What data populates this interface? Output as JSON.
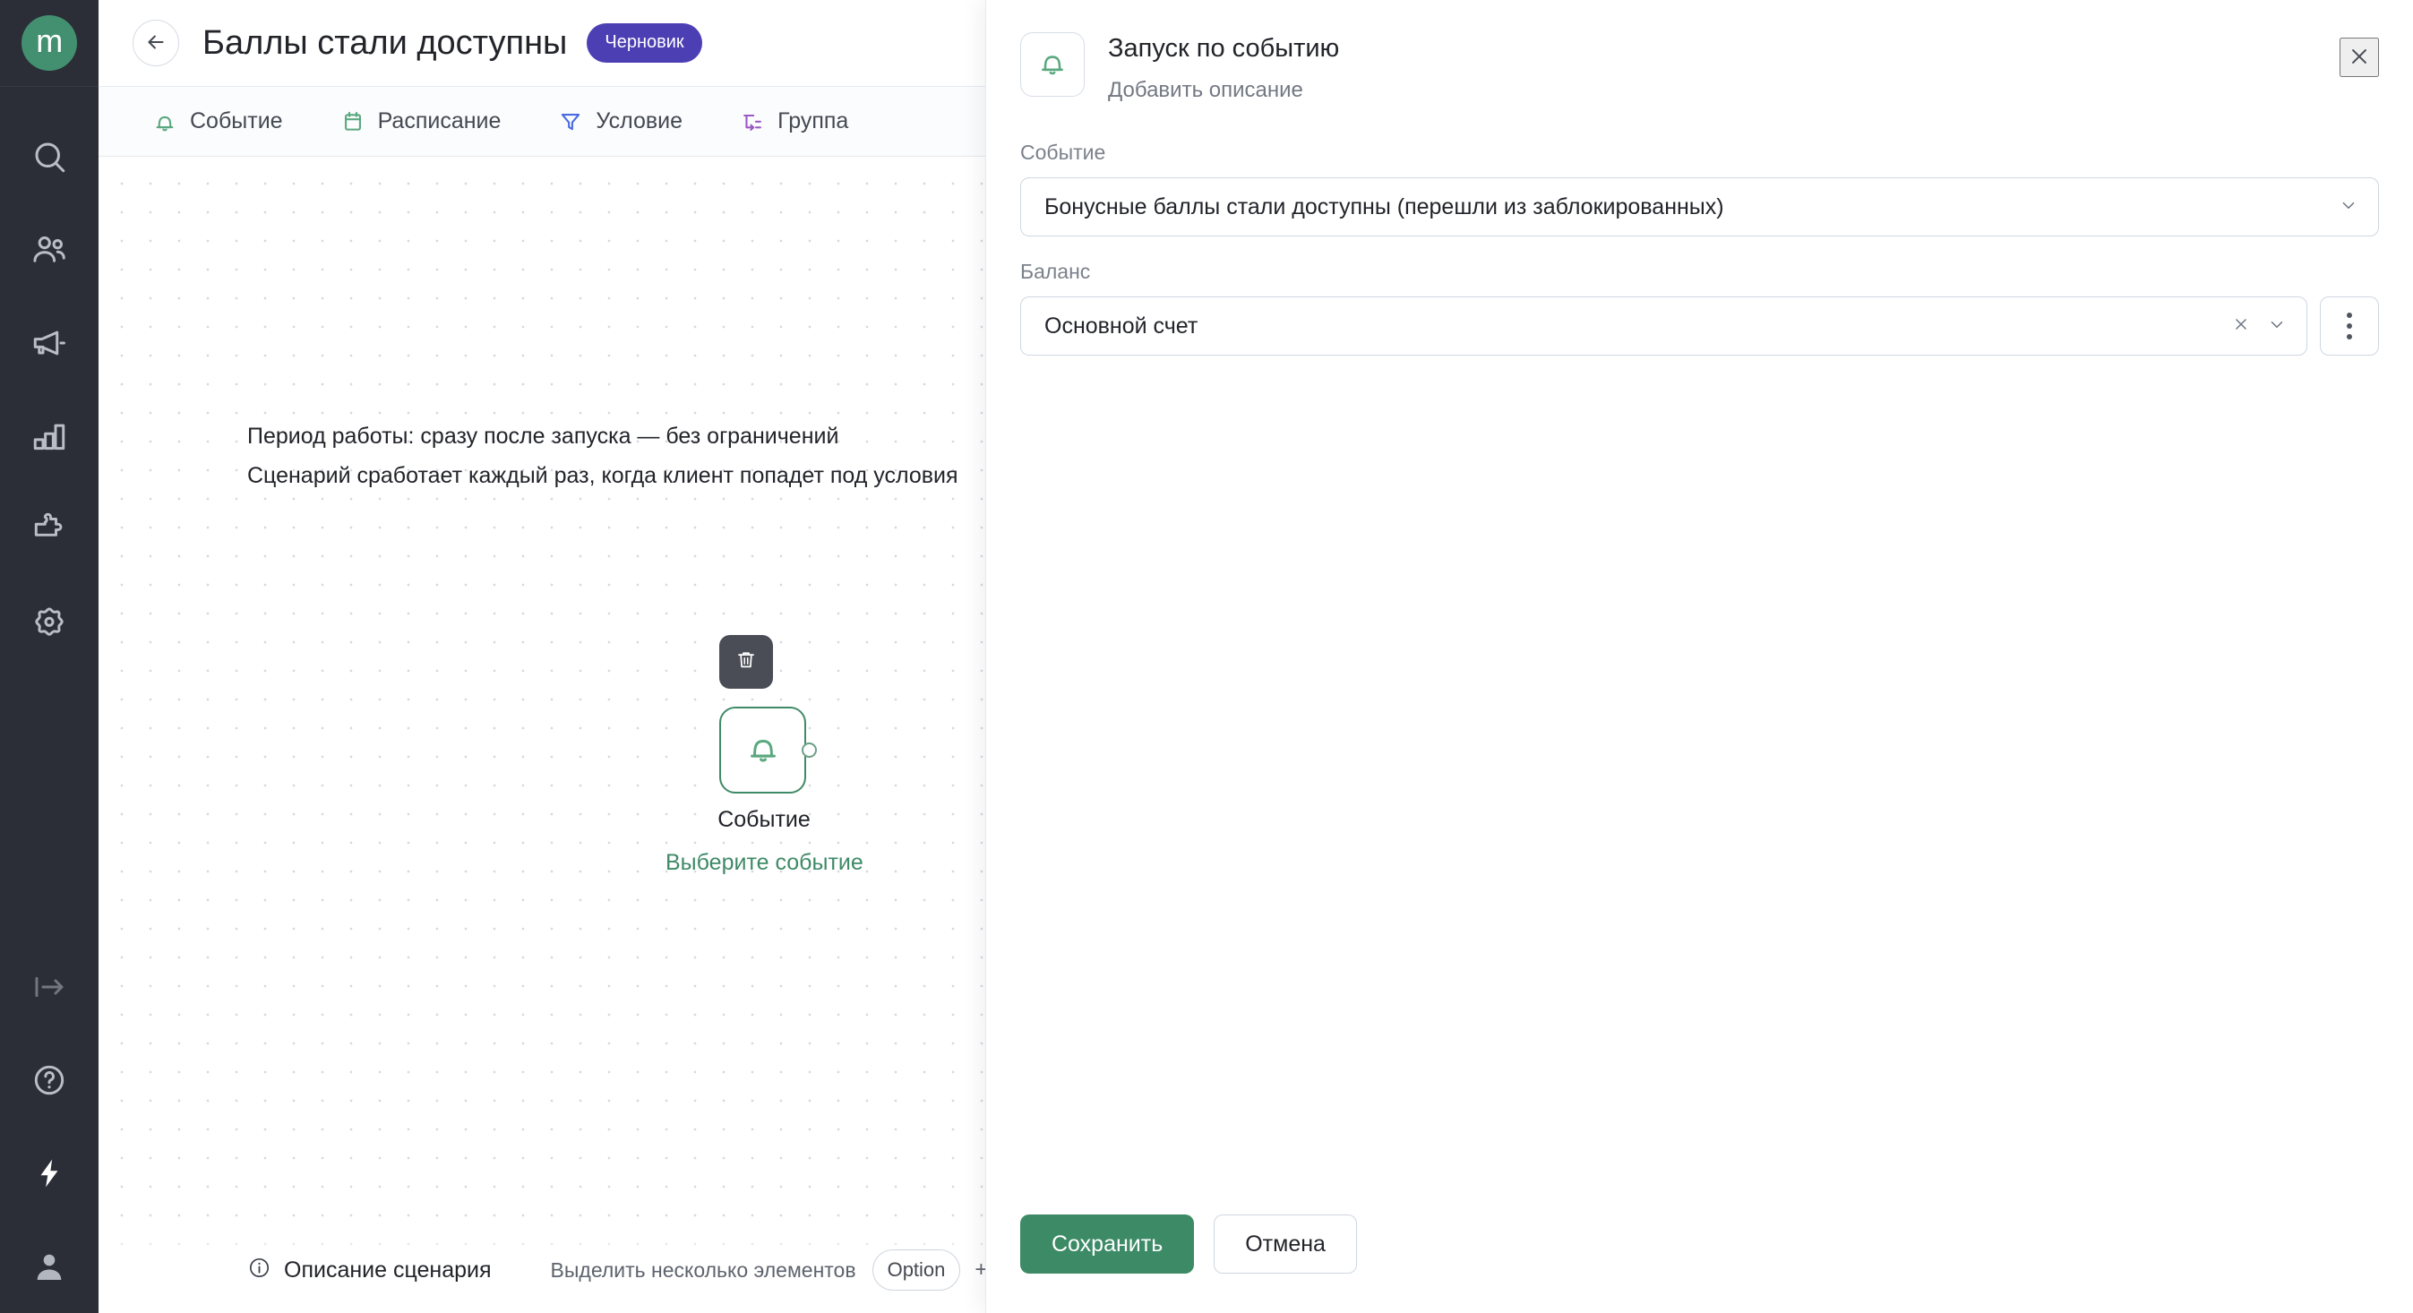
{
  "brand": {
    "logo_letter": "m",
    "logo_color": "#439070"
  },
  "sidebar": {
    "items": [
      {
        "name": "search-icon",
        "label": "Поиск"
      },
      {
        "name": "clients-icon",
        "label": "Клиенты"
      },
      {
        "name": "megaphone-icon",
        "label": "Кампании"
      },
      {
        "name": "analytics-icon",
        "label": "Аналитика"
      },
      {
        "name": "puzzle-icon",
        "label": "Интеграции"
      },
      {
        "name": "settings-icon",
        "label": "Настройки"
      }
    ],
    "bottom_items": [
      {
        "name": "expand-panel-icon",
        "label": "Развернуть меню"
      },
      {
        "name": "help-circle-icon",
        "label": "Помощь"
      },
      {
        "name": "lightning-icon",
        "label": "Быстрые действия"
      },
      {
        "name": "user-avatar-icon",
        "label": "Профиль"
      }
    ]
  },
  "header": {
    "back_label": "Назад",
    "title": "Баллы стали доступны",
    "status_badge": "Черновик",
    "badge_color": "#4c3fb4"
  },
  "tabs": [
    {
      "label": "Событие",
      "icon": "bell-icon",
      "color": "#5aa87f"
    },
    {
      "label": "Расписание",
      "icon": "calendar-icon",
      "color": "#5aa87f"
    },
    {
      "label": "Условие",
      "icon": "filter-icon",
      "color": "#4a6ae0"
    },
    {
      "label": "Группа",
      "icon": "group-icon",
      "color": "#9b59c4"
    }
  ],
  "canvas": {
    "note_line_1": "Период работы: сразу после запуска — без ограничений",
    "note_line_2": "Сценарий сработает каждый раз, когда клиент попадет под условия",
    "node": {
      "delete_tooltip": "Удалить",
      "icon": "bell-icon",
      "title": "Событие",
      "subtitle": "Выберите событие",
      "accent_color": "#3f8a67"
    }
  },
  "statusbar": {
    "description_label": "Описание сценария",
    "hint_text": "Выделить несколько элементов",
    "hint_key": "Option",
    "hint_plus": "+"
  },
  "panel": {
    "icon": "bell-icon",
    "title": "Запуск по событию",
    "description_placeholder": "Добавить описание",
    "close_label": "Закрыть",
    "fields": [
      {
        "label": "Событие",
        "value": "Бонусные баллы стали доступны (перешли из заблокированных)",
        "has_clear": false,
        "has_kebab": false
      },
      {
        "label": "Баланс",
        "value": "Основной счет",
        "has_clear": true,
        "has_kebab": true
      }
    ],
    "save_label": "Сохранить",
    "cancel_label": "Отмена",
    "save_color": "#3c8a66"
  }
}
